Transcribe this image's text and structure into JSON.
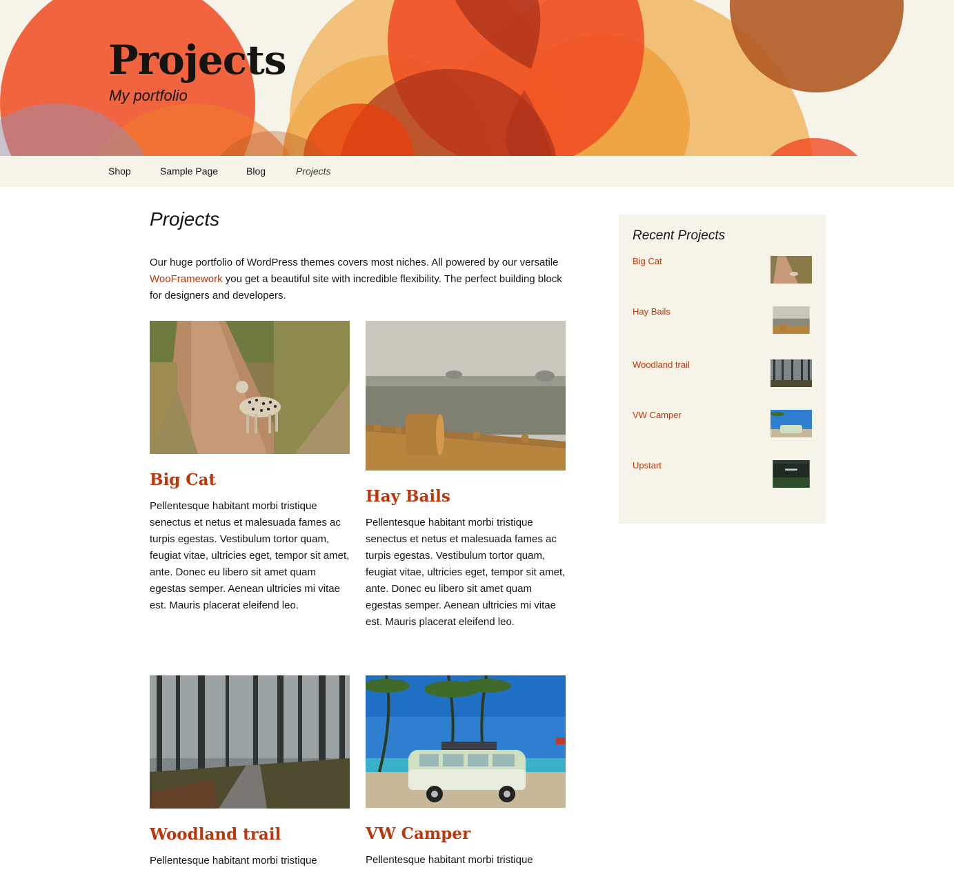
{
  "site": {
    "title": "Projects",
    "description": "My portfolio"
  },
  "nav": {
    "items": [
      {
        "label": "Shop"
      },
      {
        "label": "Sample Page"
      },
      {
        "label": "Blog"
      },
      {
        "label": "Projects"
      }
    ]
  },
  "page": {
    "title": "Projects",
    "intro_before": "Our huge portfolio of WordPress themes covers most niches. All powered by our versatile ",
    "intro_link": "WooFramework",
    "intro_after": " you get a beautiful site with incredible flexibility. The perfect building block for designers and developers."
  },
  "projects": [
    {
      "title": "Big Cat",
      "excerpt": "Pellentesque habitant morbi tristique senectus et netus et malesuada fames ac turpis egestas. Vestibulum tortor quam, feugiat vitae, ultricies eget, tempor sit amet, ante. Donec eu libero sit amet quam egestas semper. Aenean ultricies mi vitae est. Mauris placerat eleifend leo."
    },
    {
      "title": "Hay Bails",
      "excerpt": "Pellentesque habitant morbi tristique senectus et netus et malesuada fames ac turpis egestas. Vestibulum tortor quam, feugiat vitae, ultricies eget, tempor sit amet, ante. Donec eu libero sit amet quam egestas semper. Aenean ultricies mi vitae est. Mauris placerat eleifend leo."
    },
    {
      "title": "Woodland trail",
      "excerpt": "Pellentesque habitant morbi tristique"
    },
    {
      "title": "VW Camper",
      "excerpt": "Pellentesque habitant morbi tristique"
    }
  ],
  "sidebar": {
    "widget_title": "Recent Projects",
    "items": [
      {
        "label": "Big Cat"
      },
      {
        "label": "Hay Bails"
      },
      {
        "label": "Woodland trail"
      },
      {
        "label": "VW Camper"
      },
      {
        "label": "Upstart"
      }
    ]
  },
  "colors": {
    "link": "#bc360a",
    "header_bg": "#f6f4e8",
    "text": "#141412"
  }
}
